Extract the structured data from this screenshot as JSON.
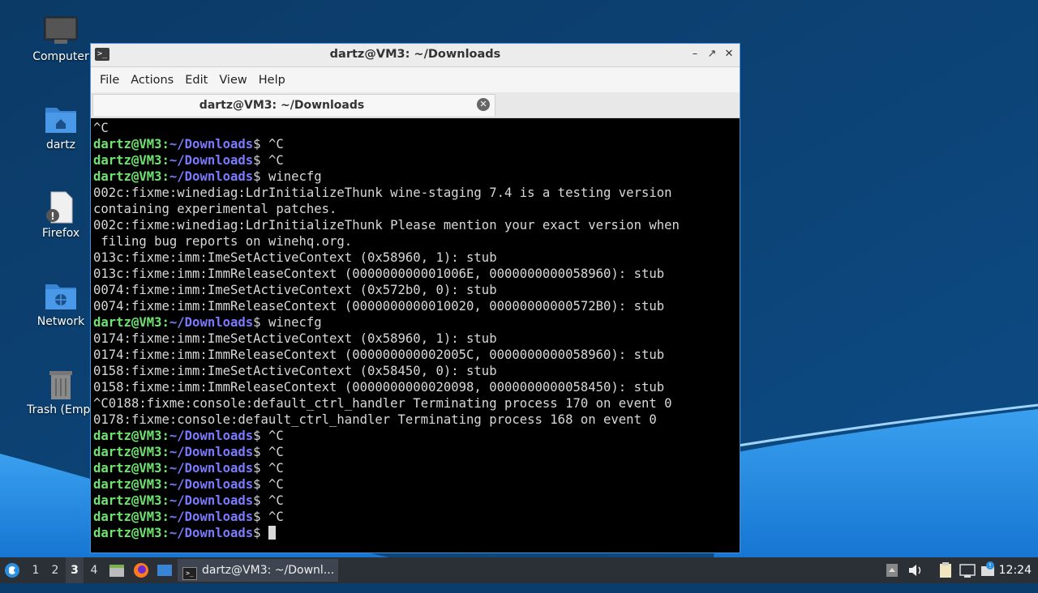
{
  "desktop": {
    "icons": [
      {
        "label": "Computer",
        "icon": "monitor-icon"
      },
      {
        "label": "dartz",
        "icon": "home-folder-icon"
      },
      {
        "label": "Firefox",
        "icon": "file-warning-icon"
      },
      {
        "label": "Network",
        "icon": "network-folder-icon"
      },
      {
        "label": "Trash (Empt",
        "icon": "trash-icon"
      }
    ]
  },
  "window": {
    "title": "dartz@VM3: ~/Downloads",
    "menu": [
      "File",
      "Actions",
      "Edit",
      "View",
      "Help"
    ],
    "tab_label": "dartz@VM3: ~/Downloads"
  },
  "terminal": {
    "prompt_user": "dartz@VM3",
    "prompt_path": "~/Downloads",
    "lines": [
      {
        "type": "out",
        "text": "^C"
      },
      {
        "type": "prompt",
        "cmd": " ^C"
      },
      {
        "type": "prompt",
        "cmd": " ^C"
      },
      {
        "type": "prompt",
        "cmd": " winecfg"
      },
      {
        "type": "out",
        "text": "002c:fixme:winediag:LdrInitializeThunk wine-staging 7.4 is a testing version"
      },
      {
        "type": "out",
        "text": "containing experimental patches."
      },
      {
        "type": "out",
        "text": "002c:fixme:winediag:LdrInitializeThunk Please mention your exact version when"
      },
      {
        "type": "out",
        "text": " filing bug reports on winehq.org."
      },
      {
        "type": "out",
        "text": "013c:fixme:imm:ImeSetActiveContext (0x58960, 1): stub"
      },
      {
        "type": "out",
        "text": "013c:fixme:imm:ImmReleaseContext (000000000001006E, 0000000000058960): stub"
      },
      {
        "type": "out",
        "text": "0074:fixme:imm:ImeSetActiveContext (0x572b0, 0): stub"
      },
      {
        "type": "out",
        "text": "0074:fixme:imm:ImmReleaseContext (0000000000010020, 00000000000572B0): stub"
      },
      {
        "type": "prompt",
        "cmd": " winecfg"
      },
      {
        "type": "out",
        "text": "0174:fixme:imm:ImeSetActiveContext (0x58960, 1): stub"
      },
      {
        "type": "out",
        "text": "0174:fixme:imm:ImmReleaseContext (000000000002005C, 0000000000058960): stub"
      },
      {
        "type": "out",
        "text": "0158:fixme:imm:ImeSetActiveContext (0x58450, 0): stub"
      },
      {
        "type": "out",
        "text": "0158:fixme:imm:ImmReleaseContext (0000000000020098, 0000000000058450): stub"
      },
      {
        "type": "out",
        "text": "^C0188:fixme:console:default_ctrl_handler Terminating process 170 on event 0"
      },
      {
        "type": "out",
        "text": "0178:fixme:console:default_ctrl_handler Terminating process 168 on event 0"
      },
      {
        "type": "prompt",
        "cmd": " ^C"
      },
      {
        "type": "prompt",
        "cmd": " ^C"
      },
      {
        "type": "prompt",
        "cmd": " ^C"
      },
      {
        "type": "prompt",
        "cmd": " ^C"
      },
      {
        "type": "prompt",
        "cmd": " ^C"
      },
      {
        "type": "prompt",
        "cmd": " ^C"
      },
      {
        "type": "prompt",
        "cmd": " ",
        "cursor": true
      }
    ]
  },
  "taskbar": {
    "workspaces": [
      "1",
      "2",
      "3",
      "4"
    ],
    "active_workspace": "3",
    "task_label": "dartz@VM3: ~/Downl...",
    "clock": "12:24"
  },
  "colors": {
    "prompt_user": "#6fe36f",
    "prompt_path": "#7a7aff",
    "window_border": "#4a90d9",
    "taskbar": "#2b2f36"
  }
}
